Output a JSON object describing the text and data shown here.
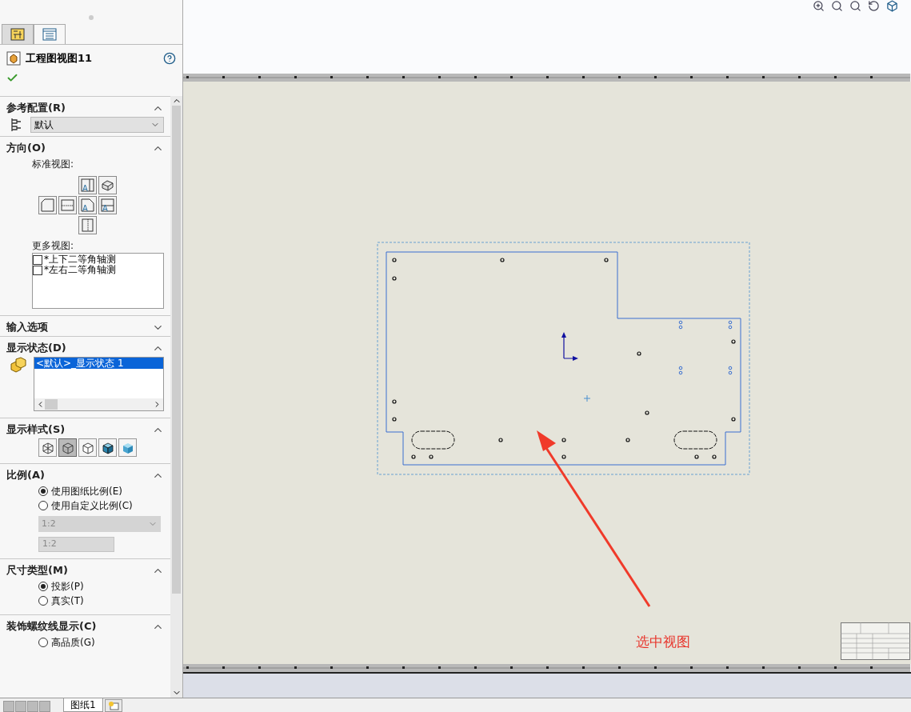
{
  "panel": {
    "tabs": [
      {
        "kind": "property",
        "selected": false
      },
      {
        "kind": "config",
        "selected": true
      }
    ],
    "title": "工程图视图11",
    "sections": [
      {
        "kind": "reference_config",
        "title": "参考配置(R)",
        "expanded": true,
        "value": "默认"
      },
      {
        "kind": "orientation",
        "title": "方向(O)",
        "expanded": true,
        "standard_label": "标准视图:",
        "standard_views": [
          {
            "kind": "left",
            "letter": "A"
          },
          {
            "kind": "iso"
          },
          {
            "kind": "right"
          },
          {
            "kind": "bottom"
          },
          {
            "kind": "front",
            "letter": "A"
          },
          {
            "kind": "top",
            "letter": "A"
          },
          {
            "kind": "back"
          }
        ],
        "more_label": "更多视图:",
        "more_views": [
          {
            "label": "*上下二等角轴测",
            "checked": false
          },
          {
            "label": "*左右二等角轴测",
            "checked": false
          }
        ]
      },
      {
        "kind": "import_options",
        "title": "输入选项",
        "expanded": false
      },
      {
        "kind": "display_state",
        "title": "显示状态(D)",
        "expanded": true,
        "items": [
          {
            "label": "<默认>_显示状态 1",
            "selected": true
          }
        ]
      },
      {
        "kind": "display_style",
        "title": "显示样式(S)",
        "expanded": true,
        "styles": [
          {
            "kind": "wireframe",
            "selected": false
          },
          {
            "kind": "hidden_visible",
            "selected": true
          },
          {
            "kind": "hidden_removed",
            "selected": false
          },
          {
            "kind": "shaded_edges",
            "selected": false
          },
          {
            "kind": "shaded",
            "selected": false
          }
        ]
      },
      {
        "kind": "scale",
        "title": "比例(A)",
        "expanded": true,
        "options": [
          {
            "label": "使用图纸比例(E)",
            "selected": true
          },
          {
            "label": "使用自定义比例(C)",
            "selected": false
          }
        ],
        "dropdown": "1:2",
        "field": "1:2",
        "disabled": true
      },
      {
        "kind": "dimension_type",
        "title": "尺寸类型(M)",
        "expanded": true,
        "options": [
          {
            "label": "投影(P)",
            "selected": true
          },
          {
            "label": "真实(T)",
            "selected": false
          }
        ]
      },
      {
        "kind": "cosmetic_thread",
        "title": "装饰螺纹线显示(C)",
        "expanded": true,
        "options": [
          {
            "label": "高品质(G)",
            "selected": false
          }
        ]
      }
    ]
  },
  "sheet_tabs": [
    {
      "label": "图纸1",
      "selected": true
    }
  ],
  "annotation": {
    "text": "选中视图"
  }
}
